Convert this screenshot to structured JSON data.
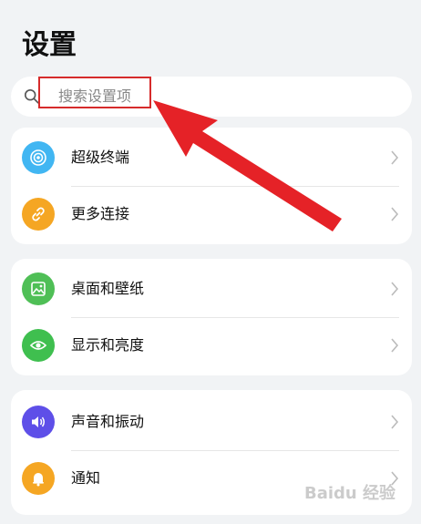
{
  "header": {
    "title": "设置"
  },
  "search": {
    "placeholder": "搜索设置项"
  },
  "groups": [
    {
      "items": [
        {
          "label": "超级终端",
          "icon": "super-device-icon",
          "color": "#41b6f2"
        },
        {
          "label": "更多连接",
          "icon": "link-icon",
          "color": "#f5a623"
        }
      ]
    },
    {
      "items": [
        {
          "label": "桌面和壁纸",
          "icon": "wallpaper-icon",
          "color": "#4fbf56"
        },
        {
          "label": "显示和亮度",
          "icon": "eye-icon",
          "color": "#3fbf4f"
        }
      ]
    },
    {
      "items": [
        {
          "label": "声音和振动",
          "icon": "speaker-icon",
          "color": "#5e4fe8"
        },
        {
          "label": "通知",
          "icon": "bell-icon",
          "color": "#f5a623"
        }
      ]
    }
  ],
  "watermark": {
    "text": "Baidu 经验"
  },
  "annotation": {
    "box_color": "#d62b2b",
    "arrow_color": "#e52227"
  }
}
